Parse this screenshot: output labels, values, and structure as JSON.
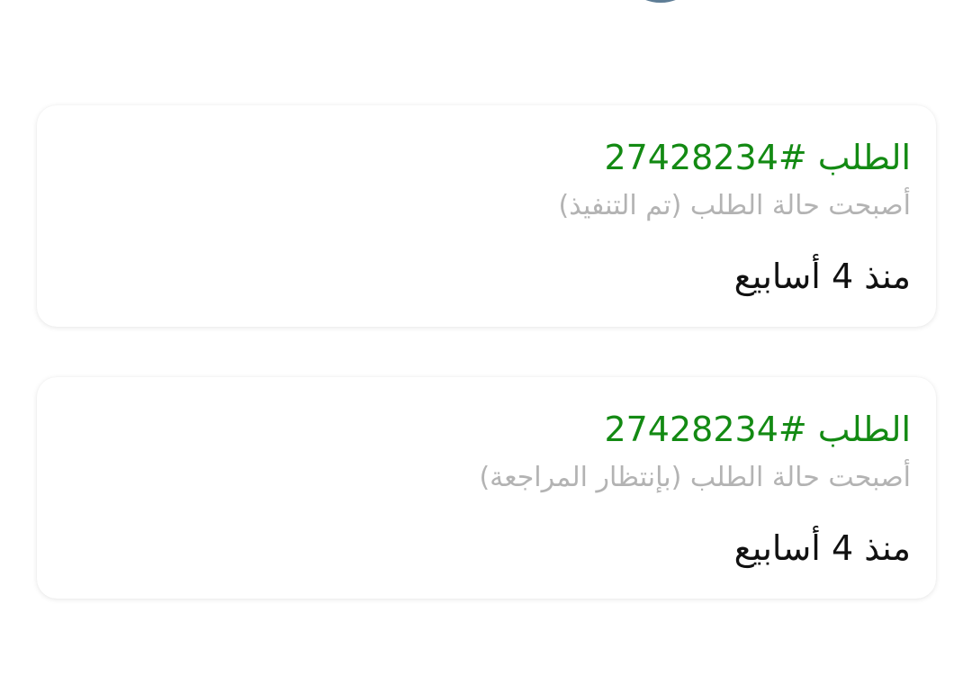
{
  "notifications": [
    {
      "title": "الطلب #27428234",
      "status": "أصبحت حالة الطلب (تم التنفيذ)",
      "time": "منذ 4 أسابيع"
    },
    {
      "title": "الطلب #27428234",
      "status": "أصبحت حالة الطلب (بإنتظار المراجعة)",
      "time": "منذ 4 أسابيع"
    }
  ],
  "colors": {
    "title": "#138a13",
    "status": "#b3b3b3",
    "time": "#111111",
    "avatar_ring": "#5e7d96"
  }
}
